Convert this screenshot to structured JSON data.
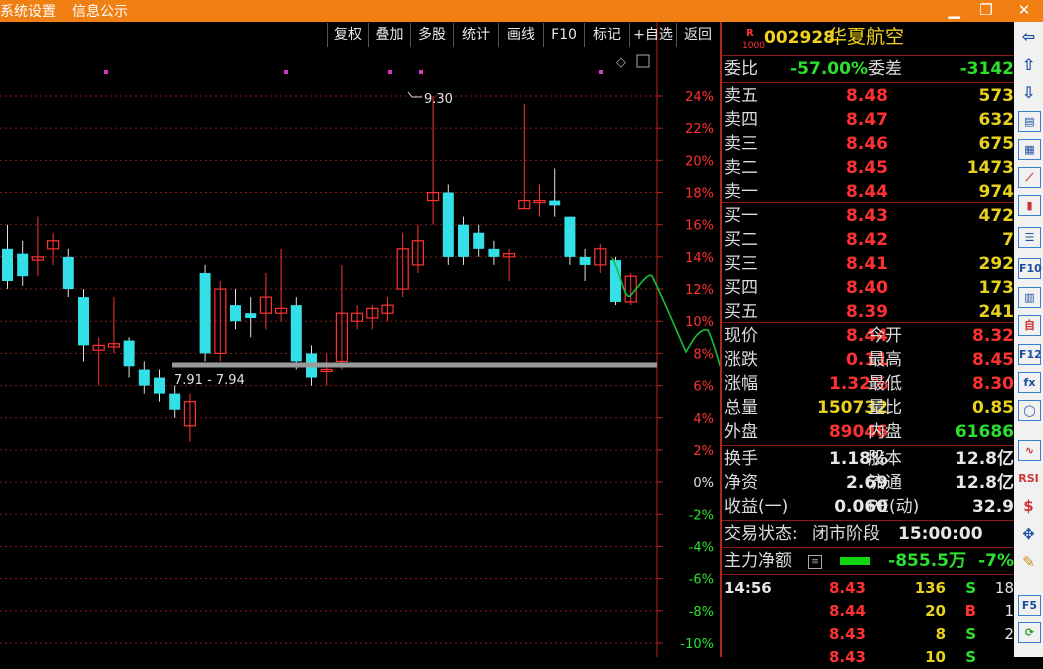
{
  "menu": {
    "item1": "系统设置",
    "item2": "信息公示"
  },
  "window_controls": [
    "minimize-icon",
    "restore-icon",
    "close-icon"
  ],
  "toolbar": [
    "复权",
    "叠加",
    "多股",
    "统计",
    "画线",
    "F10",
    "标记",
    "+自选",
    "返回"
  ],
  "stock": {
    "badge_top": "R",
    "badge_bottom": "1000",
    "code": "002928",
    "name": "华夏航空"
  },
  "ratio": {
    "label1": "委比",
    "value1": "-57.00%",
    "label2": "委差",
    "value2": "-3142"
  },
  "sell": [
    {
      "label": "卖五",
      "price": "8.48",
      "vol": "573"
    },
    {
      "label": "卖四",
      "price": "8.47",
      "vol": "632"
    },
    {
      "label": "卖三",
      "price": "8.46",
      "vol": "675"
    },
    {
      "label": "卖二",
      "price": "8.45",
      "vol": "1473"
    },
    {
      "label": "卖一",
      "price": "8.44",
      "vol": "974"
    }
  ],
  "buy": [
    {
      "label": "买一",
      "price": "8.43",
      "vol": "472"
    },
    {
      "label": "买二",
      "price": "8.42",
      "vol": "7"
    },
    {
      "label": "买三",
      "price": "8.41",
      "vol": "292"
    },
    {
      "label": "买四",
      "price": "8.40",
      "vol": "173"
    },
    {
      "label": "买五",
      "price": "8.39",
      "vol": "241"
    }
  ],
  "stats": [
    {
      "l1": "现价",
      "v1": "8.44",
      "l2": "今开",
      "v2": "8.32"
    },
    {
      "l1": "涨跌",
      "v1": "0.11",
      "l2": "最高",
      "v2": "8.45"
    },
    {
      "l1": "涨幅",
      "v1": "1.32%",
      "l2": "最低",
      "v2": "8.30"
    },
    {
      "l1": "总量",
      "v1": "150732",
      "l2": "量比",
      "v2": "0.85"
    },
    {
      "l1": "外盘",
      "v1": "89046",
      "l2": "内盘",
      "v2": "61686"
    }
  ],
  "fund": [
    {
      "l1": "换手",
      "v1": "1.18%",
      "l2": "股本",
      "v2": "12.8亿"
    },
    {
      "l1": "净资",
      "v1": "2.69",
      "l2": "流通",
      "v2": "12.8亿"
    },
    {
      "l1": "收益(一)",
      "v1": "0.060",
      "l2": "PE(动)",
      "v2": "32.9"
    }
  ],
  "trade_status": {
    "label": "交易状态:",
    "state": "闭市阶段",
    "time": "15:00:00"
  },
  "main_flow": {
    "label": "主力净额",
    "value": "-855.5万",
    "pct": "-7%"
  },
  "ticks": [
    {
      "time": "14:56",
      "price": "8.43",
      "vol": "136",
      "side": "S",
      "n": "18"
    },
    {
      "time": "",
      "price": "8.44",
      "vol": "20",
      "side": "B",
      "n": "1"
    },
    {
      "time": "",
      "price": "8.43",
      "vol": "8",
      "side": "S",
      "n": "2"
    },
    {
      "time": "",
      "price": "8.43",
      "vol": "10",
      "side": "S",
      "n": ""
    }
  ],
  "chart_data": {
    "type": "candlestick",
    "y_axis_labels": [
      "24%",
      "22%",
      "20%",
      "18%",
      "16%",
      "14%",
      "12%",
      "10%",
      "8%",
      "6%",
      "4%",
      "2%",
      "0%",
      "-2%",
      "-4%",
      "-6%",
      "-8%",
      "-10%"
    ],
    "annotation_high": "9.30",
    "annotation_range": "7.91 - 7.94",
    "candles": [
      {
        "o": 14.5,
        "c": 12.5,
        "h": 16,
        "l": 12
      },
      {
        "o": 14.2,
        "c": 12.8,
        "h": 15,
        "l": 12.2
      },
      {
        "o": 13.8,
        "c": 14.0,
        "h": 16.5,
        "l": 12.8
      },
      {
        "o": 14.5,
        "c": 15.0,
        "h": 15.5,
        "l": 13.5
      },
      {
        "o": 14.0,
        "c": 12.0,
        "h": 14.5,
        "l": 11.5
      },
      {
        "o": 11.5,
        "c": 8.5,
        "h": 12.0,
        "l": 7.5
      },
      {
        "o": 8.2,
        "c": 8.5,
        "h": 9.0,
        "l": 6.0
      },
      {
        "o": 8.4,
        "c": 8.6,
        "h": 11.5,
        "l": 8.0
      },
      {
        "o": 8.8,
        "c": 7.2,
        "h": 9.0,
        "l": 6.5
      },
      {
        "o": 7.0,
        "c": 6.0,
        "h": 7.5,
        "l": 5.5
      },
      {
        "o": 6.5,
        "c": 5.5,
        "h": 7.0,
        "l": 5.0
      },
      {
        "o": 5.5,
        "c": 4.5,
        "h": 6.0,
        "l": 4.0
      },
      {
        "o": 3.5,
        "c": 5.0,
        "h": 5.5,
        "l": 2.5
      },
      {
        "o": 8.0,
        "c": 13.0,
        "h": 13.5,
        "l": 7.5,
        "up": false
      },
      {
        "o": 8.0,
        "c": 12.0,
        "h": 12.5,
        "l": 7.5
      },
      {
        "o": 10.0,
        "c": 11.0,
        "h": 12.0,
        "l": 9.5,
        "up": false
      },
      {
        "o": 10.5,
        "c": 10.2,
        "h": 11.5,
        "l": 9.0
      },
      {
        "o": 10.5,
        "c": 11.5,
        "h": 13.0,
        "l": 9.5
      },
      {
        "o": 10.5,
        "c": 10.8,
        "h": 14.5,
        "l": 10.0
      },
      {
        "o": 11.0,
        "c": 7.5,
        "h": 11.5,
        "l": 7.0
      },
      {
        "o": 8.0,
        "c": 6.5,
        "h": 8.5,
        "l": 6.0
      },
      {
        "o": 7.0,
        "c": 7.0,
        "h": 8.0,
        "l": 6.0
      },
      {
        "o": 7.5,
        "c": 10.5,
        "h": 13.5,
        "l": 7.0
      },
      {
        "o": 10.0,
        "c": 10.5,
        "h": 11.0,
        "l": 9.5
      },
      {
        "o": 10.2,
        "c": 10.8,
        "h": 11.0,
        "l": 9.5
      },
      {
        "o": 10.5,
        "c": 11.0,
        "h": 11.5,
        "l": 10.0
      },
      {
        "o": 12.0,
        "c": 14.5,
        "h": 15.5,
        "l": 11.5
      },
      {
        "o": 13.5,
        "c": 15.0,
        "h": 16.0,
        "l": 13.0
      },
      {
        "o": 17.5,
        "c": 18.0,
        "h": 24.0,
        "l": 16.0
      },
      {
        "o": 18.0,
        "c": 14.0,
        "h": 18.5,
        "l": 13.5
      },
      {
        "o": 16.0,
        "c": 14.0,
        "h": 16.5,
        "l": 13.5
      },
      {
        "o": 15.5,
        "c": 14.5,
        "h": 16.0,
        "l": 14.0
      },
      {
        "o": 14.5,
        "c": 14.0,
        "h": 15.0,
        "l": 13.5
      },
      {
        "o": 14.0,
        "c": 14.2,
        "h": 14.5,
        "l": 12.5
      },
      {
        "o": 17.0,
        "c": 17.5,
        "h": 23.5,
        "l": 17.0
      },
      {
        "o": 17.5,
        "c": 17.5,
        "h": 18.5,
        "l": 16.5
      },
      {
        "o": 17.5,
        "c": 17.2,
        "h": 19.5,
        "l": 16.5
      },
      {
        "o": 16.5,
        "c": 14.0,
        "h": 16.5,
        "l": 13.5
      },
      {
        "o": 14.0,
        "c": 13.5,
        "h": 14.5,
        "l": 12.5
      },
      {
        "o": 13.5,
        "c": 14.5,
        "h": 14.8,
        "l": 13.0
      },
      {
        "o": 13.8,
        "c": 11.2,
        "h": 14.0,
        "l": 11.0
      },
      {
        "o": 11.2,
        "c": 12.8,
        "h": 13.0,
        "l": 11.0
      }
    ]
  }
}
